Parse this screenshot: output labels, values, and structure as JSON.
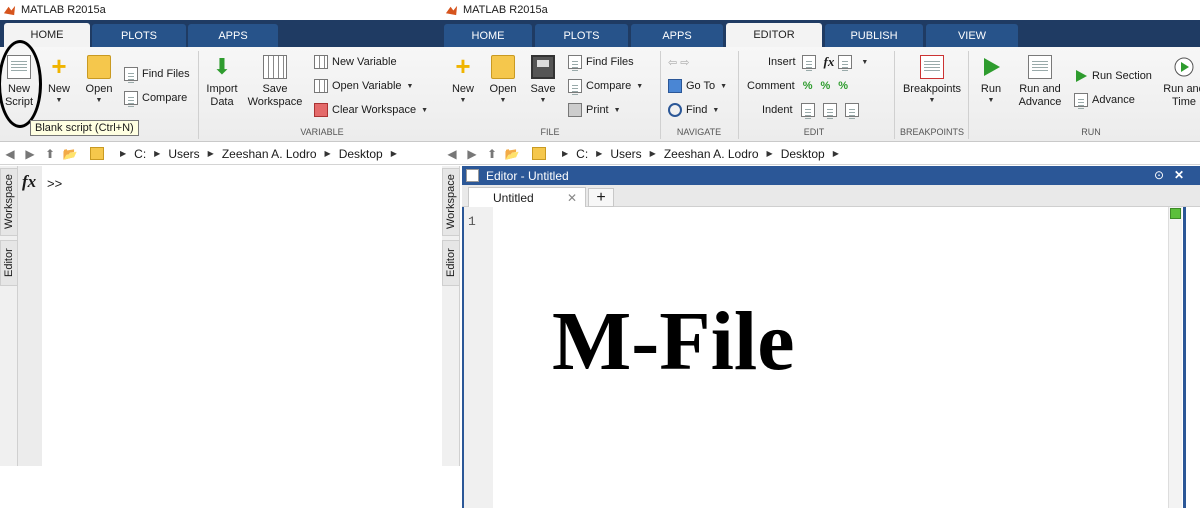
{
  "app": {
    "title": "MATLAB R2015a"
  },
  "left": {
    "tabs": [
      {
        "label": "HOME",
        "active": true
      },
      {
        "label": "PLOTS",
        "active": false
      },
      {
        "label": "APPS",
        "active": false
      }
    ],
    "ribbon": {
      "new_script": {
        "line1": "New",
        "line2": "Script"
      },
      "new": "New",
      "open": "Open",
      "find_files": "Find Files",
      "compare": "Compare",
      "import_data": {
        "line1": "Import",
        "line2": "Data"
      },
      "save_workspace": {
        "line1": "Save",
        "line2": "Workspace"
      },
      "new_variable": "New Variable",
      "open_variable": "Open Variable",
      "clear_workspace": "Clear Workspace",
      "group_variable": "VARIABLE"
    },
    "tooltip": "Blank script (Ctrl+N)",
    "breadcrumb": [
      "C:",
      "Users",
      "Zeeshan A. Lodro",
      "Desktop"
    ],
    "side_tabs": [
      "Workspace",
      "Editor"
    ],
    "command": {
      "fx": "fx",
      "prompt": ">>"
    }
  },
  "right": {
    "tabs": [
      {
        "label": "HOME",
        "active": false
      },
      {
        "label": "PLOTS",
        "active": false
      },
      {
        "label": "APPS",
        "active": false
      },
      {
        "label": "EDITOR",
        "active": true
      },
      {
        "label": "PUBLISH",
        "active": false
      },
      {
        "label": "VIEW",
        "active": false
      }
    ],
    "ribbon": {
      "new": "New",
      "open": "Open",
      "save": "Save",
      "find_files": "Find Files",
      "compare": "Compare",
      "print": "Print",
      "go_to": "Go To",
      "find": "Find",
      "insert": "Insert",
      "comment": "Comment",
      "indent": "Indent",
      "breakpoints": "Breakpoints",
      "run": "Run",
      "run_and_advance": {
        "line1": "Run and",
        "line2": "Advance"
      },
      "run_section": "Run Section",
      "advance": "Advance",
      "run_and_time": {
        "line1": "Run and",
        "line2": "Time"
      },
      "groups": {
        "file": "FILE",
        "navigate": "NAVIGATE",
        "edit": "EDIT",
        "breakpoints": "BREAKPOINTS",
        "run": "RUN"
      }
    },
    "breadcrumb": [
      "C:",
      "Users",
      "Zeeshan A. Lodro",
      "Desktop"
    ],
    "side_tabs": [
      "Workspace",
      "Editor"
    ],
    "editor": {
      "title": "Editor - Untitled",
      "tab_label": "Untitled",
      "add_tab": "+",
      "line_number": "1",
      "overlay_text": "M-File"
    }
  },
  "colors": {
    "tab_bar": "#1f3b63",
    "tab": "#27538a",
    "editor_accent": "#2b5797",
    "run_green": "#2e9c2e"
  }
}
